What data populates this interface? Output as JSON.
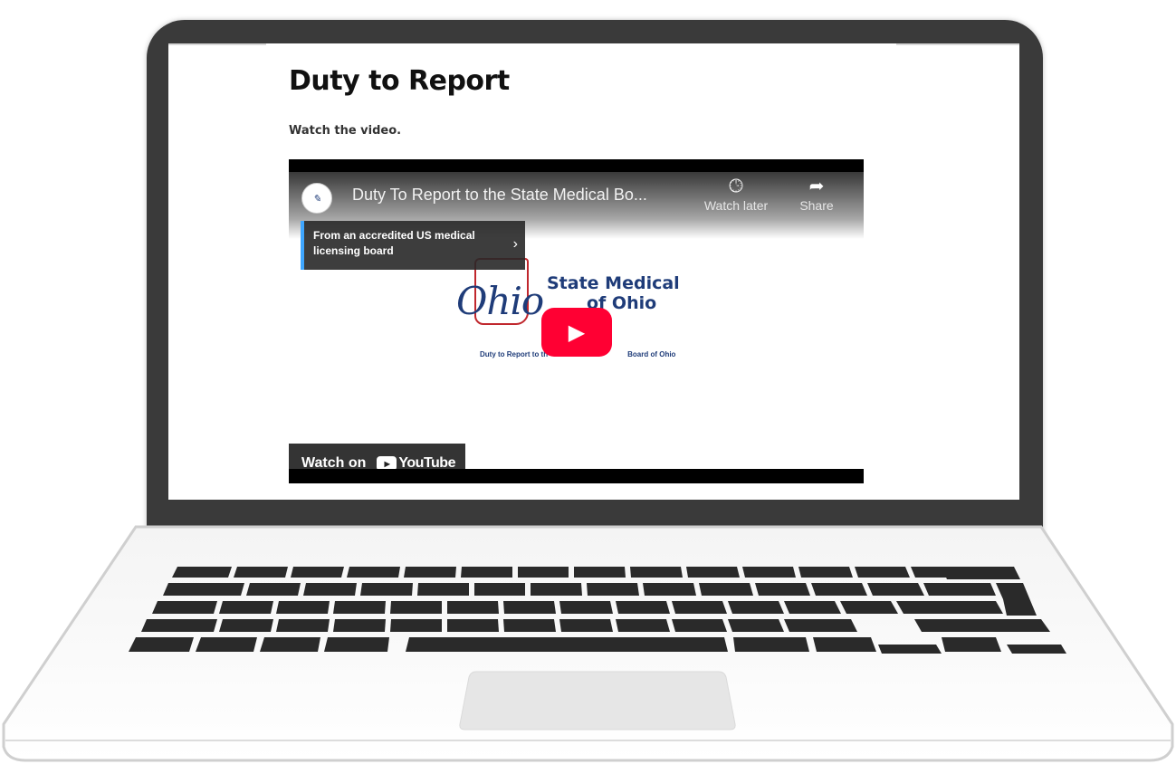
{
  "page": {
    "title": "Duty to Report",
    "subtitle": "Watch the video."
  },
  "video": {
    "title": "Duty To Report to the State Medical Bo...",
    "watch_later_label": "Watch later",
    "share_label": "Share",
    "accreditation_notice": "From an accredited US medical licensing board",
    "watch_on_label": "Watch on",
    "youtube_label": "YouTube",
    "logo": {
      "ohio_word": "Ohio",
      "line1": "State Medical",
      "line2": "of Ohio",
      "caption_left": "Duty to Report to th",
      "caption_right": "Board of Ohio"
    }
  },
  "colors": {
    "lid": "#3a3a3a",
    "youtube_red": "#ff0033",
    "ohio_blue": "#1f3c79",
    "ohio_red": "#c0272d",
    "accent_blue": "#3ea6ff"
  },
  "icons": [
    "clock-icon",
    "share-arrow-icon",
    "chevron-right-icon",
    "play-icon",
    "youtube-icon"
  ]
}
